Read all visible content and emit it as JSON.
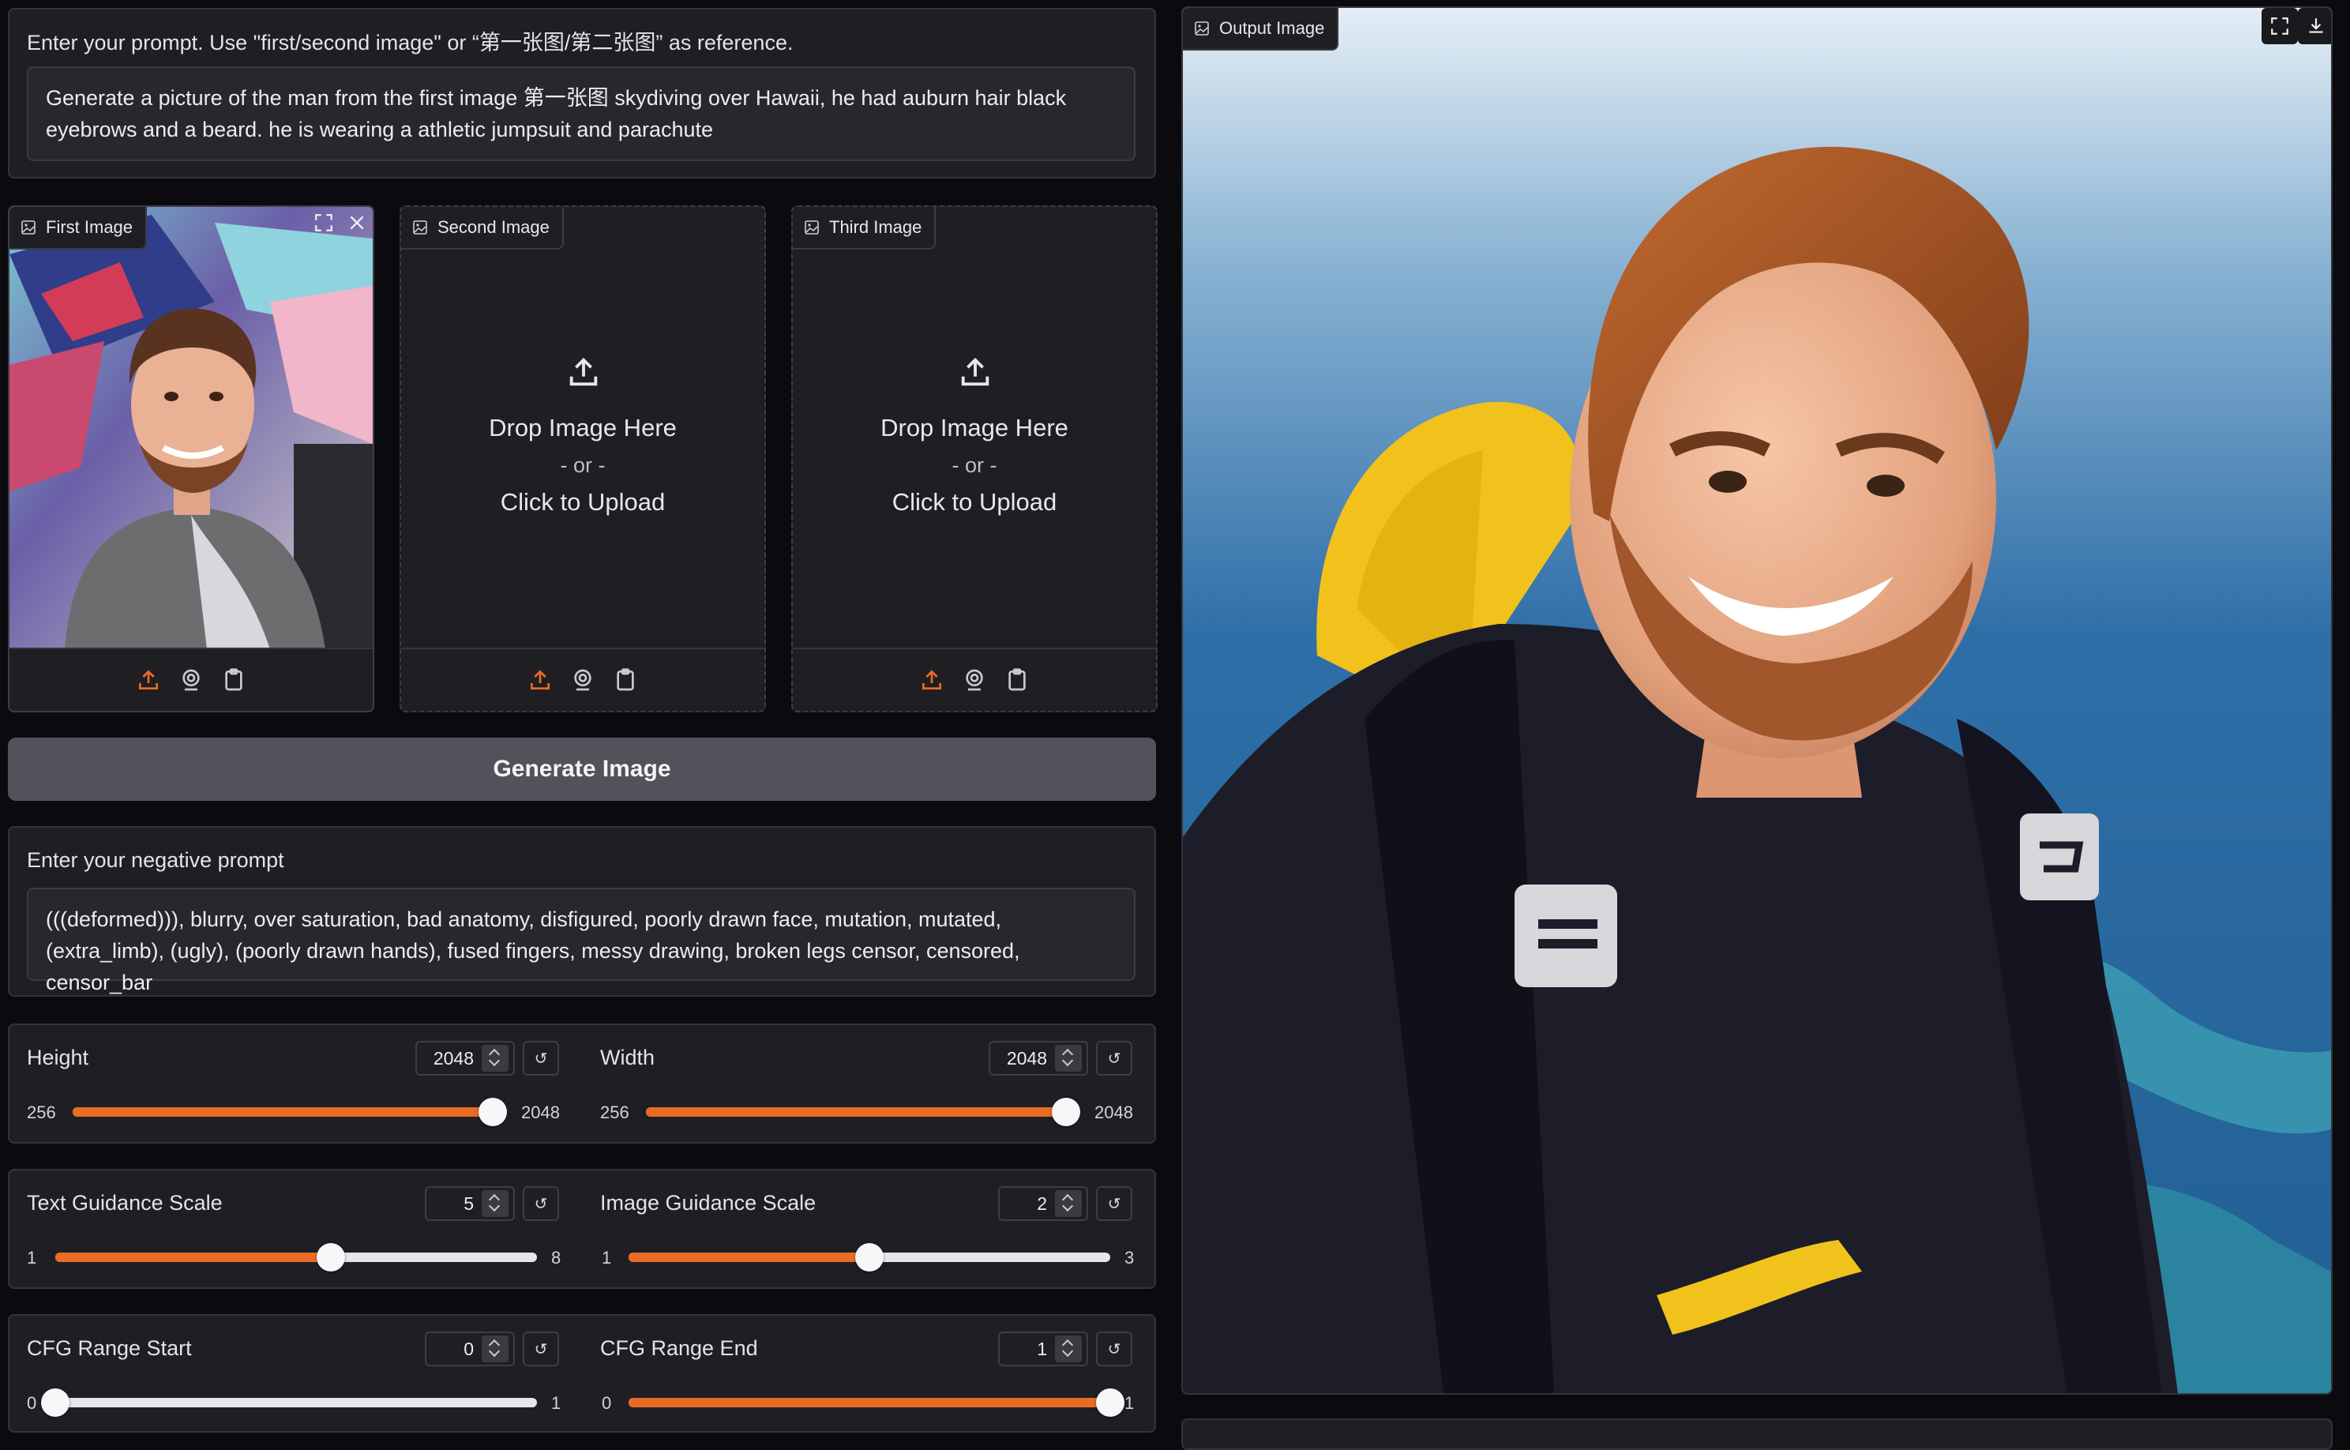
{
  "prompt": {
    "label": "Enter your prompt. Use \"first/second image\" or “第一张图/第二张图” as reference.",
    "value": "Generate a picture of the man from the first image  第一张图 skydiving over Hawaii, he had auburn hair black eyebrows and a beard. he is wearing a athletic jumpsuit and parachute"
  },
  "images": {
    "first": {
      "label": "First Image"
    },
    "second": {
      "label": "Second Image",
      "drop": "Drop Image Here",
      "or": "- or -",
      "click": "Click to Upload"
    },
    "third": {
      "label": "Third Image",
      "drop": "Drop Image Here",
      "or": "- or -",
      "click": "Click to Upload"
    }
  },
  "generate_label": "Generate Image",
  "negative": {
    "label": "Enter your negative prompt",
    "value": "(((deformed))), blurry, over saturation, bad anatomy, disfigured, poorly drawn face, mutation, mutated, (extra_limb), (ugly), (poorly drawn hands), fused fingers, messy drawing, broken legs censor, censored, censor_bar"
  },
  "sliders": {
    "height": {
      "label": "Height",
      "value": "2048",
      "min": "256",
      "max": "2048",
      "level": 1.0
    },
    "width": {
      "label": "Width",
      "value": "2048",
      "min": "256",
      "max": "2048",
      "level": 1.0
    },
    "text_guidance": {
      "label": "Text Guidance Scale",
      "value": "5",
      "min": "1",
      "max": "8",
      "level": 0.5714
    },
    "image_guidance": {
      "label": "Image Guidance Scale",
      "value": "2",
      "min": "1",
      "max": "3",
      "level": 0.5
    },
    "cfg_start": {
      "label": "CFG Range Start",
      "value": "0",
      "min": "0",
      "max": "1",
      "level": 0.0
    },
    "cfg_end": {
      "label": "CFG Range End",
      "value": "1",
      "min": "0",
      "max": "1",
      "level": 1.0
    }
  },
  "reset_glyph": "↺",
  "output": {
    "label": "Output Image"
  },
  "colors": {
    "accent": "#ea6c24",
    "panel": "#1f1f23",
    "background": "#0b0b0f",
    "button": "#52525b"
  }
}
